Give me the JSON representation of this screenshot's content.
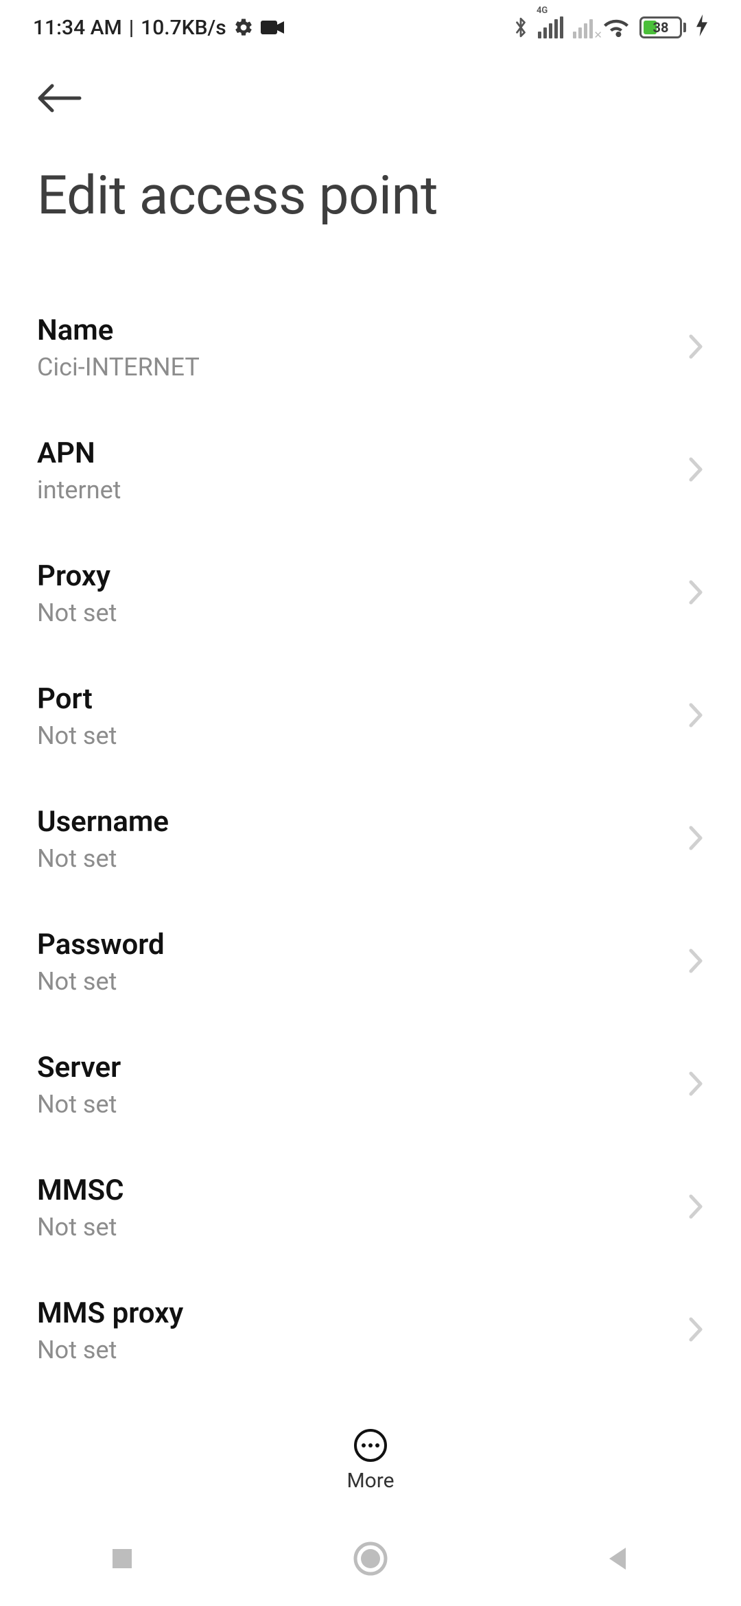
{
  "status": {
    "time": "11:34 AM",
    "speed": "10.7KB/s",
    "battery_pct": "38",
    "network_label": "4G"
  },
  "page": {
    "title": "Edit access point"
  },
  "settings": [
    {
      "label": "Name",
      "value": "Cici-INTERNET"
    },
    {
      "label": "APN",
      "value": "internet"
    },
    {
      "label": "Proxy",
      "value": "Not set"
    },
    {
      "label": "Port",
      "value": "Not set"
    },
    {
      "label": "Username",
      "value": "Not set"
    },
    {
      "label": "Password",
      "value": "Not set"
    },
    {
      "label": "Server",
      "value": "Not set"
    },
    {
      "label": "MMSC",
      "value": "Not set"
    },
    {
      "label": "MMS proxy",
      "value": "Not set"
    }
  ],
  "more_label": "More"
}
